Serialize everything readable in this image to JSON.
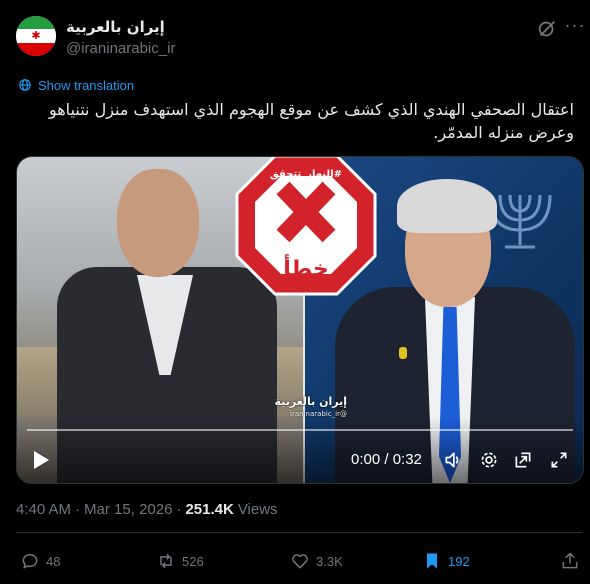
{
  "account": {
    "display_name": "إيران بالعربية",
    "handle": "@iraninarabic_ir"
  },
  "translate_label": "Show translation",
  "tweet": {
    "text": "اعتقال الصحفي الهندي الذي كشف عن موقع الهجوم الذي استهدف منزل نتنياهو وعرض منزله المدمّر."
  },
  "media": {
    "stamp_tag": "#النهار_تتحقق",
    "stamp_word": "خطأ",
    "watermark": "إيران بالعربية",
    "watermark_sub": "@iraninarabic_ir",
    "time": "0:00 / 0:32",
    "progress": 0
  },
  "meta": {
    "time": "4:40 AM",
    "dot1": "·",
    "date": "Mar 15, 2026",
    "dot2": "·",
    "views_count": "251.4K",
    "views_label": "Views"
  },
  "actions": {
    "replies": "48",
    "reposts": "526",
    "likes": "3.3K",
    "bookmarks": "192"
  },
  "colors": {
    "accent": "#1d9bf0",
    "stamp_red": "#d2232a"
  },
  "icons": [
    "grok-icon",
    "more-icon",
    "globe-icon",
    "play-icon",
    "volume-icon",
    "settings-icon",
    "pip-icon",
    "fullscreen-icon",
    "reply-icon",
    "repost-icon",
    "like-icon",
    "bookmark-icon",
    "share-icon"
  ]
}
